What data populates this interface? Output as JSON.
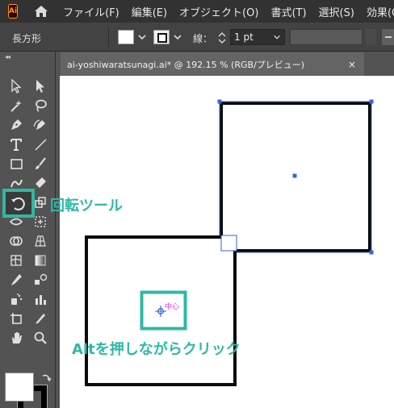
{
  "app": {
    "logo_text": "Ai"
  },
  "menu": {
    "items": [
      "ファイル(F)",
      "編集(E)",
      "オブジェクト(O)",
      "書式(T)",
      "選択(S)",
      "効果(C)"
    ]
  },
  "control_bar": {
    "selection_name": "長方形",
    "stroke_label": "線：",
    "stroke_weight": "1 pt"
  },
  "document": {
    "tab_title": "ai-yoshiwaratsunagi.ai* @ 192.15 % (RGB/プレビュー)",
    "close_glyph": "×"
  },
  "canvas": {
    "center_label": "中心"
  },
  "callouts": {
    "rotate_tool": "回転ツール",
    "alt_click": "Altを押しながらクリック"
  },
  "colors": {
    "accent": "#2fb8a6",
    "selection_blue": "#3a63d8",
    "center_magenta": "#e23ad2"
  },
  "tools": [
    "selection-tool-icon",
    "direct-selection-tool-icon",
    "magic-wand-tool-icon",
    "lasso-tool-icon",
    "pen-tool-icon",
    "curvature-tool-icon",
    "type-tool-icon",
    "line-segment-tool-icon",
    "rectangle-tool-icon",
    "paintbrush-tool-icon",
    "shaper-tool-icon",
    "eraser-tool-icon",
    "rotate-tool-icon",
    "scale-tool-icon",
    "width-tool-icon",
    "free-transform-tool-icon",
    "shape-builder-tool-icon",
    "perspective-grid-tool-icon",
    "mesh-tool-icon",
    "gradient-tool-icon",
    "eyedropper-tool-icon",
    "blend-tool-icon",
    "symbol-sprayer-tool-icon",
    "column-graph-tool-icon",
    "artboard-tool-icon",
    "slice-tool-icon",
    "hand-tool-icon",
    "zoom-tool-icon"
  ]
}
